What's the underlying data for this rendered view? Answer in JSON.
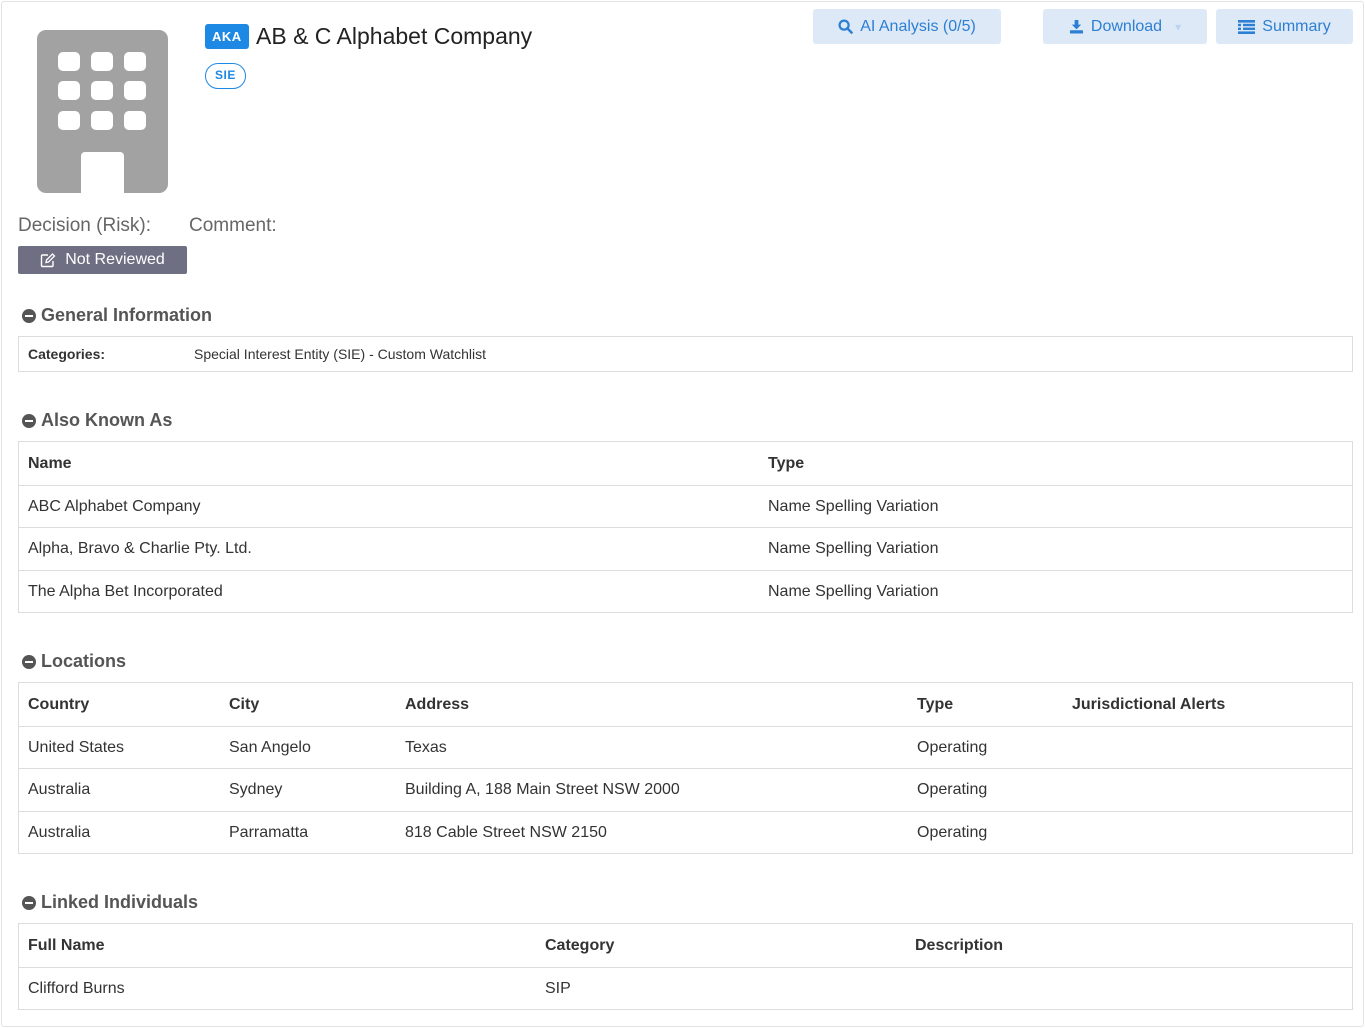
{
  "header": {
    "aka_badge": "AKA",
    "title": "AB & C Alphabet Company",
    "category_badge": "SIE",
    "logo_icon": "building-icon"
  },
  "toolbar": {
    "ai_analysis_label": "AI Analysis (0/5)",
    "download_label": "Download",
    "summary_label": "Summary"
  },
  "decision": {
    "label": "Decision (Risk):",
    "comment_label": "Comment:",
    "status_label": "Not Reviewed",
    "status_color": "#6f6f83"
  },
  "general_information": {
    "title": "General Information",
    "categories_label": "Categories:",
    "categories_value": "Special Interest Entity (SIE) - Custom Watchlist"
  },
  "also_known_as": {
    "title": "Also Known As",
    "headers": [
      "Name",
      "Type"
    ],
    "rows": [
      [
        "ABC Alphabet Company",
        "Name Spelling Variation"
      ],
      [
        "Alpha, Bravo & Charlie Pty. Ltd.",
        "Name Spelling Variation"
      ],
      [
        "The Alpha Bet Incorporated",
        "Name Spelling Variation"
      ]
    ]
  },
  "locations": {
    "title": "Locations",
    "headers": [
      "Country",
      "City",
      "Address",
      "Type",
      "Jurisdictional Alerts"
    ],
    "rows": [
      [
        "United States",
        "San Angelo",
        "Texas",
        "Operating",
        ""
      ],
      [
        "Australia",
        "Sydney",
        "Building A, 188 Main Street NSW 2000",
        "Operating",
        ""
      ],
      [
        "Australia",
        "Parramatta",
        "818 Cable Street NSW 2150",
        "Operating",
        ""
      ]
    ]
  },
  "linked_individuals": {
    "title": "Linked Individuals",
    "headers": [
      "Full Name",
      "Category",
      "Description"
    ],
    "rows": [
      [
        "Clifford Burns",
        "SIP",
        ""
      ]
    ]
  },
  "colors": {
    "accent": "#1e88e5",
    "button_bg": "#dde9f7",
    "button_text": "#2d7fd3"
  }
}
